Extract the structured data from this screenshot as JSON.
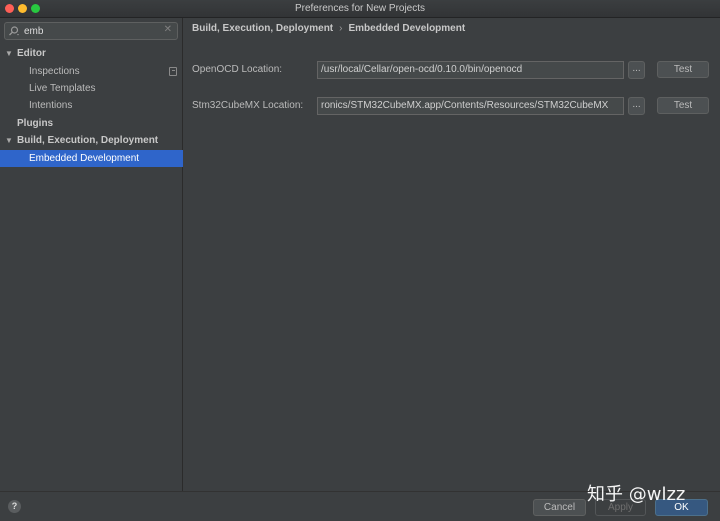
{
  "window": {
    "title": "Preferences for New Projects"
  },
  "search": {
    "value": "emb",
    "icon": "search-icon"
  },
  "sidebar": {
    "items": [
      {
        "label": "Editor",
        "expanded": true
      },
      {
        "label": "Inspections"
      },
      {
        "label": "Live Templates"
      },
      {
        "label": "Intentions"
      },
      {
        "label": "Plugins"
      },
      {
        "label": "Build, Execution, Deployment",
        "expanded": true
      },
      {
        "label": "Embedded Development",
        "selected": true
      }
    ]
  },
  "main": {
    "breadcrumb": {
      "parent": "Build, Execution, Deployment",
      "separator": "›",
      "current": "Embedded Development"
    },
    "openocd": {
      "label": "OpenOCD Location:",
      "value": "/usr/local/Cellar/open-ocd/0.10.0/bin/openocd",
      "browse": "...",
      "test": "Test"
    },
    "stm32": {
      "label": "Stm32CubeMX Location:",
      "value": "ronics/STM32CubeMX.app/Contents/Resources/STM32CubeMX",
      "browse": "...",
      "test": "Test"
    }
  },
  "footer": {
    "help": "?",
    "cancel": "Cancel",
    "apply": "Apply",
    "ok": "OK"
  },
  "watermark": "知乎 @wlzz",
  "colors": {
    "selection": "#2f65ca",
    "ok_button": "#365880",
    "background": "#3c3f41"
  }
}
